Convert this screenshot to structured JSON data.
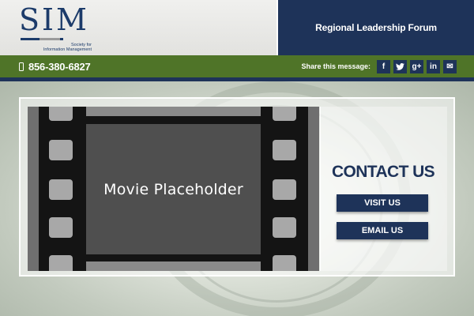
{
  "logo": {
    "letters": "SIM",
    "tagline_line1": "Society for",
    "tagline_line2": "Information Management"
  },
  "header": {
    "title": "Regional Leadership Forum"
  },
  "topbar": {
    "phone": "856-380-6827",
    "share_label": "Share this message:",
    "share_buttons": [
      {
        "icon": "facebook-icon",
        "glyph": "f"
      },
      {
        "icon": "twitter-icon",
        "glyph": "t"
      },
      {
        "icon": "google-plus-icon",
        "glyph": "g+"
      },
      {
        "icon": "linkedin-icon",
        "glyph": "in"
      },
      {
        "icon": "email-icon",
        "glyph": "✉"
      }
    ]
  },
  "video": {
    "placeholder_text": "Movie Placeholder"
  },
  "contact": {
    "heading": "CONTACT US",
    "visit_label": "VISIT US",
    "email_label": "EMAIL US"
  },
  "colors": {
    "navy": "#1e3359",
    "green": "#4f7428",
    "white": "#ffffff"
  }
}
